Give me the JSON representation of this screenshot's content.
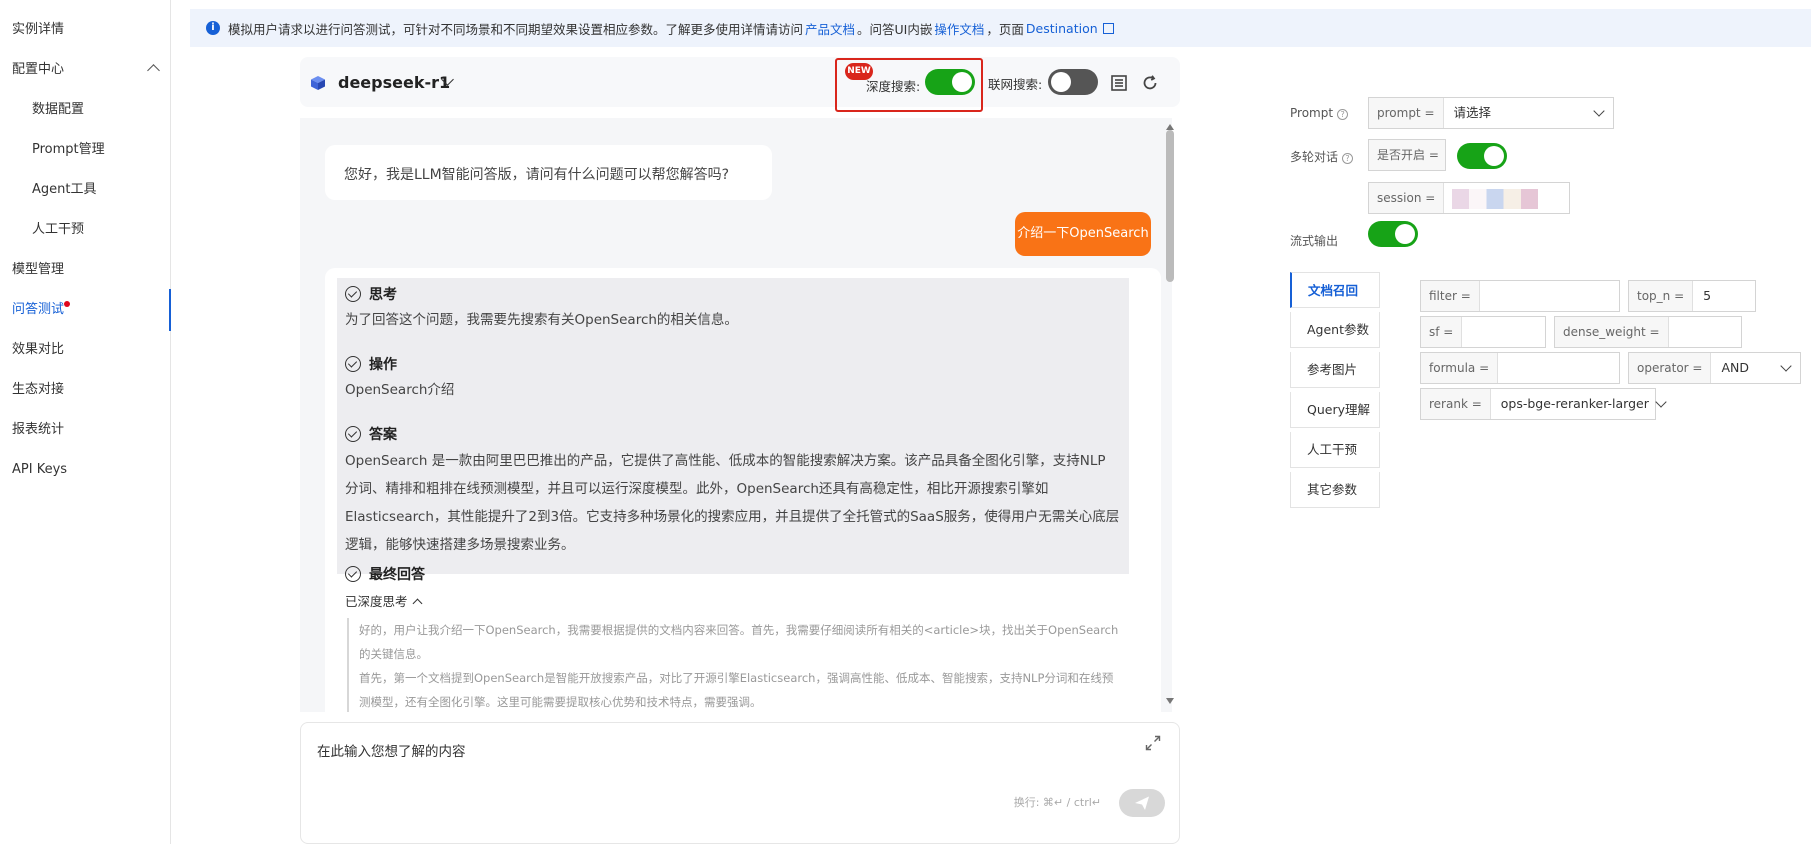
{
  "sidebar": {
    "items": [
      {
        "label": "实例详情",
        "type": "top"
      },
      {
        "label": "配置中心",
        "type": "top",
        "expanded": true
      },
      {
        "label": "数据配置",
        "type": "sub"
      },
      {
        "label": "Prompt管理",
        "type": "sub"
      },
      {
        "label": "Agent工具",
        "type": "sub"
      },
      {
        "label": "人工干预",
        "type": "sub"
      },
      {
        "label": "模型管理",
        "type": "top"
      },
      {
        "label": "问答测试",
        "type": "top",
        "active": true,
        "badge_dot": true
      },
      {
        "label": "效果对比",
        "type": "top"
      },
      {
        "label": "生态对接",
        "type": "top"
      },
      {
        "label": "报表统计",
        "type": "top"
      },
      {
        "label": "API Keys",
        "type": "top"
      }
    ]
  },
  "banner": {
    "text": "模拟用户请求以进行问答测试，可针对不同场景和不同期望效果设置相应参数。了解更多使用详情请访问",
    "link_docs": "产品文档",
    "text2": "。问答UI内嵌",
    "link_ops": "操作文档",
    "text3": "，页面",
    "link_dest": "Destination"
  },
  "chat": {
    "model_name": "deepseek-r1",
    "new_badge": "NEW",
    "deep_search_label": "深度搜索:",
    "deep_search_on": true,
    "web_search_label": "联网搜索:",
    "web_search_on": false,
    "greeting": "您好，我是LLM智能问答版，请问有什么问题可以帮您解答吗?",
    "user_message": "介绍一下OpenSearch",
    "sections": {
      "think_title": "思考",
      "think_text": "为了回答这个问题，我需要先搜索有关OpenSearch的相关信息。",
      "action_title": "操作",
      "action_text": "OpenSearch介绍",
      "answer_title": "答案",
      "answer_lines": [
        "OpenSearch 是一款由阿里巴巴推出的产品，它提供了高性能、低成本的智能搜索解决方案。该产品具备全图化引擎，支持NLP",
        "分词、精排和粗排在线预测模型，并且可以运行深度模型。此外，OpenSearch还具有高稳定性，相比开源搜索引擎如",
        "Elasticsearch，其性能提升了2到3倍。它支持多种场景化的搜索应用，并且提供了全托管式的SaaS服务，使得用户无需关心底层",
        "逻辑，能够快速搭建多场景搜索业务。"
      ],
      "final_title": "最终回答",
      "deep_think_label": "已深度思考",
      "quote_lines": [
        "好的，用户让我介绍一下OpenSearch，我需要根据提供的文档内容来回答。首先，我需要仔细阅读所有相关的<article>块，找出关于OpenSearch",
        "的关键信息。",
        "首先，第一个文档提到OpenSearch是智能开放搜索产品，对比了开源引擎Elasticsearch，强调高性能、低成本、智能搜索，支持NLP分词和在线预",
        "测模型，还有全图化引擎。这里可能需要提取核心优势和技术特点，需要强调。"
      ]
    },
    "input_placeholder": "在此输入您想了解的内容",
    "input_hint": "换行: ⌘↵ / ctrl↵"
  },
  "params": {
    "prompt_label": "Prompt",
    "prompt_prefix": "prompt =",
    "prompt_value": "请选择",
    "multi_turn_label": "多轮对话",
    "multi_turn_prefix": "是否开启 =",
    "multi_turn_on": true,
    "session_prefix": "session =",
    "stream_label": "流式输出",
    "stream_on": true,
    "tabs": [
      {
        "label": "文档召回",
        "active": true
      },
      {
        "label": "Agent参数"
      },
      {
        "label": "参考图片"
      },
      {
        "label": "Query理解"
      },
      {
        "label": "人工干预"
      },
      {
        "label": "其它参数"
      }
    ],
    "fields": {
      "filter_prefix": "filter =",
      "filter_value": "",
      "top_n_prefix": "top_n =",
      "top_n_value": "5",
      "sf_prefix": "sf =",
      "sf_value": "",
      "dense_weight_prefix": "dense_weight =",
      "dense_weight_value": "",
      "formula_prefix": "formula =",
      "formula_value": "",
      "operator_prefix": "operator =",
      "operator_value": "AND",
      "rerank_prefix": "rerank =",
      "rerank_value": "ops-bge-reranker-larger"
    }
  },
  "colors": {
    "primary": "#1660d6",
    "toggle_on": "#17a317",
    "user_bubble": "#f97316",
    "highlight": "#d9261c"
  }
}
